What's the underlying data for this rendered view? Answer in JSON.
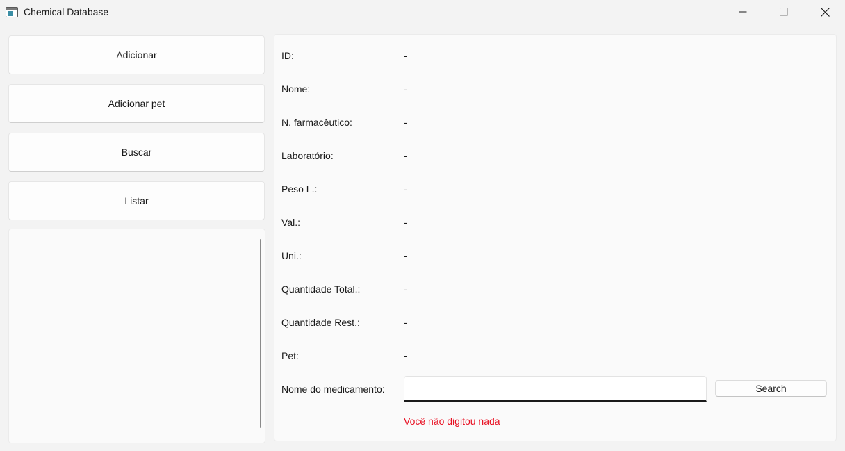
{
  "window": {
    "title": "Chemical Database",
    "controls": [
      "minimize-icon",
      "maximize-icon",
      "close-icon"
    ]
  },
  "nav": {
    "items": [
      {
        "label": "Adicionar"
      },
      {
        "label": "Adicionar pet"
      },
      {
        "label": "Buscar"
      },
      {
        "label": "Listar"
      }
    ]
  },
  "details": {
    "fields": [
      {
        "label": "ID:",
        "value": "-"
      },
      {
        "label": "Nome:",
        "value": "-"
      },
      {
        "label": "N. farmacêutico:",
        "value": "-"
      },
      {
        "label": "Laboratório:",
        "value": "-"
      },
      {
        "label": "Peso L.:",
        "value": "-"
      },
      {
        "label": "Val.:",
        "value": "-"
      },
      {
        "label": "Uni.:",
        "value": "-"
      },
      {
        "label": "Quantidade Total.:",
        "value": "-"
      },
      {
        "label": "Quantidade Rest.:",
        "value": "-"
      },
      {
        "label": "Pet:",
        "value": "-"
      }
    ]
  },
  "search": {
    "label": "Nome do medicamento:",
    "value": "",
    "button_label": "Search",
    "error_message": "Você não digitou nada"
  },
  "colors": {
    "background": "#f3f3f3",
    "panel": "#fafafa",
    "error": "#e81123"
  }
}
